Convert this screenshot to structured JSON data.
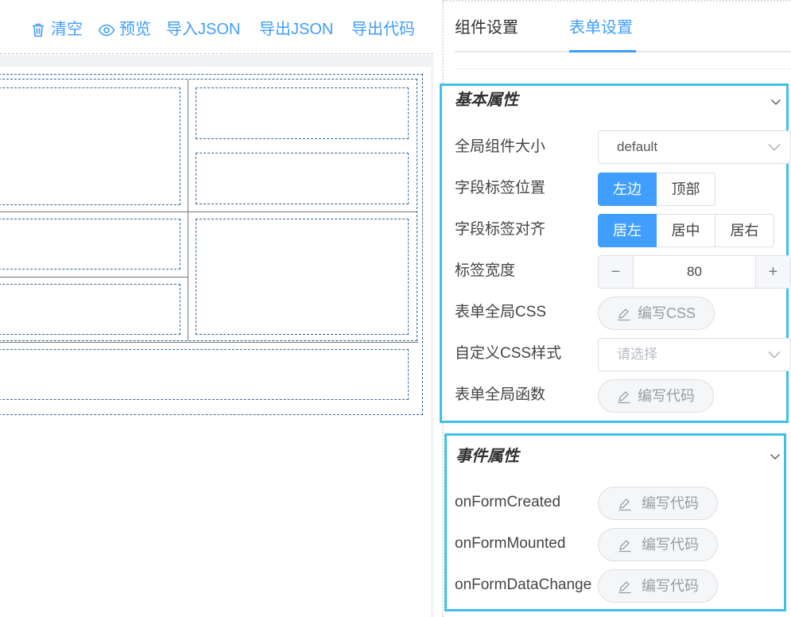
{
  "toolbar": {
    "clear": "清空",
    "preview": "预览",
    "import_json": "导入JSON",
    "export_json": "导出JSON",
    "export_code": "导出代码"
  },
  "tabs": {
    "component": "组件设置",
    "form": "表单设置"
  },
  "basic": {
    "title": "基本属性",
    "size_label": "全局组件大小",
    "size_value": "default",
    "label_pos_label": "字段标签位置",
    "label_pos_left": "左边",
    "label_pos_top": "顶部",
    "label_align_label": "字段标签对齐",
    "align_left": "居左",
    "align_center": "居中",
    "align_right": "居右",
    "width_label": "标签宽度",
    "width_minus": "−",
    "width_value": "80",
    "width_plus": "+",
    "css_label": "表单全局CSS",
    "css_btn": "编写CSS",
    "custom_css_label": "自定义CSS样式",
    "custom_css_placeholder": "请选择",
    "func_label": "表单全局函数",
    "func_btn": "编写代码"
  },
  "events": {
    "title": "事件属性",
    "created_label": "onFormCreated",
    "mounted_label": "onFormMounted",
    "change_label": "onFormDataChange",
    "btn": "编写代码"
  },
  "colors": {
    "accent": "#409eff",
    "section_border": "#40c0e8"
  }
}
